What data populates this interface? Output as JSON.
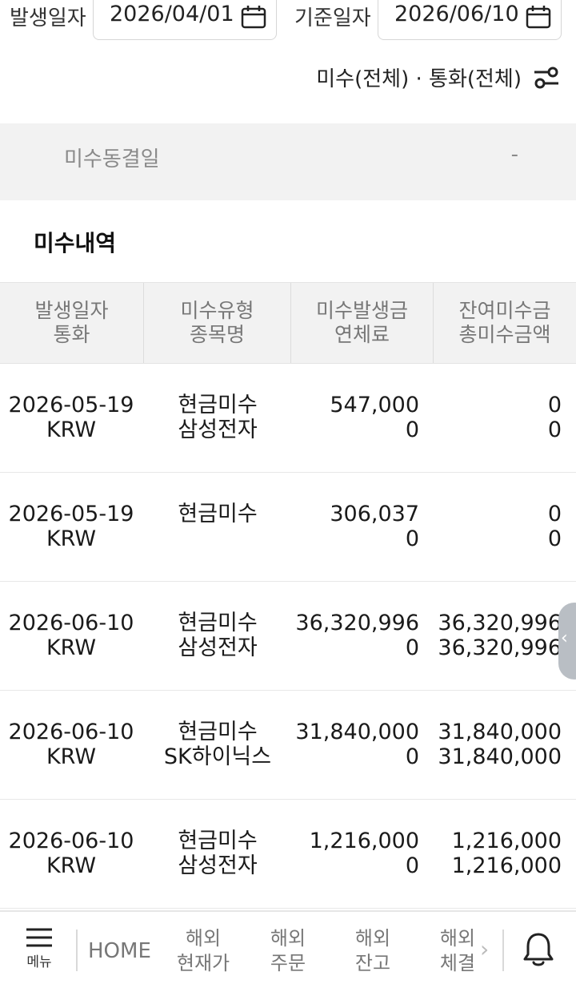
{
  "filters": {
    "start_label": "발생일자",
    "start_date": "2026/04/01",
    "base_label": "기준일자",
    "base_date": "2026/06/10",
    "scope_text": "미수(전체) · 통화(전체)"
  },
  "freeze": {
    "label": "미수동결일",
    "value": "-"
  },
  "section_title": "미수내역",
  "table": {
    "headers": [
      {
        "line1": "발생일자",
        "line2": "통화"
      },
      {
        "line1": "미수유형",
        "line2": "종목명"
      },
      {
        "line1": "미수발생금",
        "line2": "연체료"
      },
      {
        "line1": "잔여미수금",
        "line2": "총미수금액"
      }
    ],
    "rows": [
      {
        "date": "2026-05-19",
        "currency": "KRW",
        "type": "현금미수",
        "name": "삼성전자",
        "amount": "547,000",
        "late_fee": "0",
        "remaining": "0",
        "total": "0"
      },
      {
        "date": "2026-05-19",
        "currency": "KRW",
        "type": "현금미수",
        "name": "",
        "amount": "306,037",
        "late_fee": "0",
        "remaining": "0",
        "total": "0"
      },
      {
        "date": "2026-06-10",
        "currency": "KRW",
        "type": "현금미수",
        "name": "삼성전자",
        "amount": "36,320,996",
        "late_fee": "0",
        "remaining": "36,320,996",
        "total": "36,320,996"
      },
      {
        "date": "2026-06-10",
        "currency": "KRW",
        "type": "현금미수",
        "name": "SK하이닉스",
        "amount": "31,840,000",
        "late_fee": "0",
        "remaining": "31,840,000",
        "total": "31,840,000"
      },
      {
        "date": "2026-06-10",
        "currency": "KRW",
        "type": "현금미수",
        "name": "삼성전자",
        "amount": "1,216,000",
        "late_fee": "0",
        "remaining": "1,216,000",
        "total": "1,216,000"
      }
    ]
  },
  "side_tab_glyph": "‹",
  "nav": {
    "menu_label": "메뉴",
    "home": "HOME",
    "items": [
      {
        "line1": "해외",
        "line2": "현재가"
      },
      {
        "line1": "해외",
        "line2": "주문"
      },
      {
        "line1": "해외",
        "line2": "잔고"
      },
      {
        "line1": "해외",
        "line2": "체결"
      }
    ],
    "more_glyph": "›"
  },
  "icons": {
    "calendar": "calendar-icon",
    "filter": "filter-settings-icon",
    "menu": "hamburger-icon",
    "bell": "bell-icon"
  }
}
